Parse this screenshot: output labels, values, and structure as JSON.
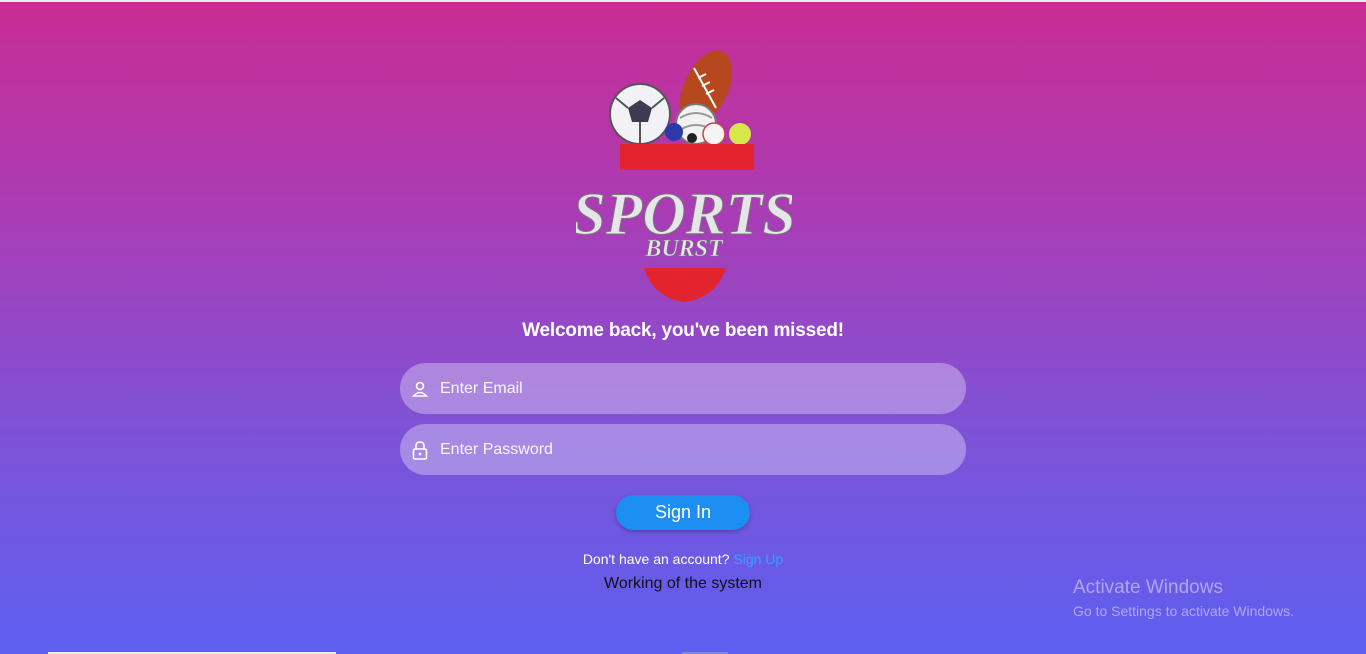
{
  "app": {
    "logo_text_top": "SPORTS",
    "logo_text_bottom": "BURST"
  },
  "login": {
    "welcome": "Welcome back, you've been missed!",
    "email_placeholder": "Enter Email",
    "password_placeholder": "Enter Password",
    "signin_label": "Sign In",
    "no_account_text": "Don't have an account?",
    "signup_link": "Sign Up",
    "working_text": "Working of the system"
  },
  "watermark": {
    "title": "Activate Windows",
    "subtitle": "Go to Settings to activate Windows."
  },
  "icons": {
    "email": "person-icon",
    "password": "lock-icon"
  },
  "colors": {
    "gradient_top": "#c92c93",
    "gradient_bottom": "#5d5ff0",
    "button": "#1e8ff2",
    "link": "#29a8ff"
  }
}
